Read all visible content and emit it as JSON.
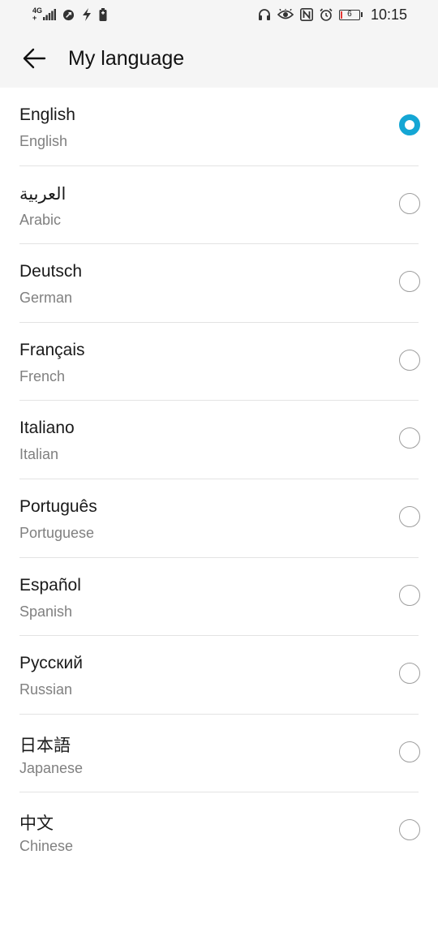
{
  "status_bar": {
    "network_top": "4G",
    "network_bottom": "+",
    "battery_level": "6",
    "time": "10:15",
    "icons_left": [
      "signal-icon",
      "data-saver-icon",
      "flash-icon",
      "battery-saver-icon"
    ],
    "icons_right": [
      "headset-icon",
      "eye-comfort-icon",
      "nfc-icon",
      "alarm-icon",
      "battery-icon"
    ]
  },
  "header": {
    "title": "My language",
    "back_icon": "arrow-left-icon"
  },
  "colors": {
    "accent": "#14a6d4",
    "primary_text": "#1a1a1a",
    "secondary_text": "#808080",
    "divider": "#e3e3e3",
    "bar_background": "#f5f5f5"
  },
  "languages": [
    {
      "native": "English",
      "english": "English",
      "selected": true
    },
    {
      "native": "العربية",
      "english": "Arabic",
      "selected": false
    },
    {
      "native": "Deutsch",
      "english": "German",
      "selected": false
    },
    {
      "native": "Français",
      "english": "French",
      "selected": false
    },
    {
      "native": "Italiano",
      "english": "Italian",
      "selected": false
    },
    {
      "native": "Português",
      "english": "Portuguese",
      "selected": false
    },
    {
      "native": "Español",
      "english": "Spanish",
      "selected": false
    },
    {
      "native": "Русский",
      "english": "Russian",
      "selected": false
    },
    {
      "native": "日本語",
      "english": "Japanese",
      "selected": false
    },
    {
      "native": "中文",
      "english": "Chinese",
      "selected": false
    }
  ]
}
